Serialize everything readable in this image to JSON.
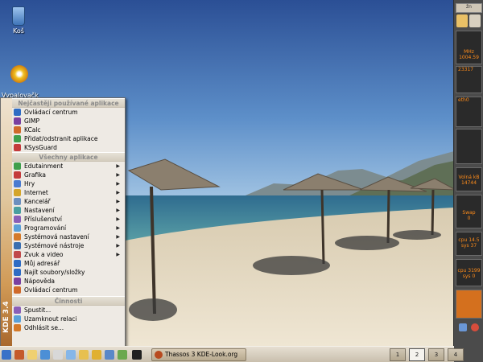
{
  "desktop": {
    "icons": [
      {
        "label": "Koš"
      },
      {
        "label": "Vypalovačk\na CD (hda)"
      }
    ]
  },
  "kmenu": {
    "side_label": "KDE 3.4",
    "headers": {
      "frequent": "Nejčastěji používané aplikace",
      "all": "Všechny aplikace",
      "actions": "Činnosti"
    },
    "frequent": [
      "Ovládací centrum",
      "GIMP",
      "KCalc",
      "Přidat/odstranit aplikace",
      "KSysGuard"
    ],
    "all": [
      {
        "label": "Edutainment",
        "sub": true
      },
      {
        "label": "Grafika",
        "sub": true
      },
      {
        "label": "Hry",
        "sub": true
      },
      {
        "label": "Internet",
        "sub": true
      },
      {
        "label": "Kancelář",
        "sub": true
      },
      {
        "label": "Nastavení",
        "sub": true
      },
      {
        "label": "Příslušenství",
        "sub": true
      },
      {
        "label": "Programování",
        "sub": true
      },
      {
        "label": "Systémová nastavení",
        "sub": true
      },
      {
        "label": "Systémové nástroje",
        "sub": true
      },
      {
        "label": "Zvuk a video",
        "sub": true
      },
      {
        "label": "Můj adresář",
        "sub": false
      },
      {
        "label": "Najít soubory/složky",
        "sub": false
      },
      {
        "label": "Nápověda",
        "sub": false
      },
      {
        "label": "Ovládací centrum",
        "sub": false
      }
    ],
    "actions": [
      "Spustit...",
      "Uzamknout relaci",
      "Odhlásit se..."
    ]
  },
  "taskbar": {
    "task_label": "Thassos 3 KDE-Look.org",
    "desktops": [
      "1",
      "2",
      "3",
      "4"
    ],
    "active_desktop": "2"
  },
  "rpanel": {
    "clock_label": "žn",
    "cpu_label": "MHz",
    "cpu_value": "1004.59",
    "cpu_small": "23317",
    "net_label": "eth0",
    "mem_label": "Volná kB",
    "mem_value": "14744",
    "swap_label": "Swap",
    "swap_value": "0",
    "cpu1": "cpu 14.5",
    "cpu1b": "sys 37",
    "cpu2": "cpu 3199",
    "cpu2b": "sys 0"
  }
}
